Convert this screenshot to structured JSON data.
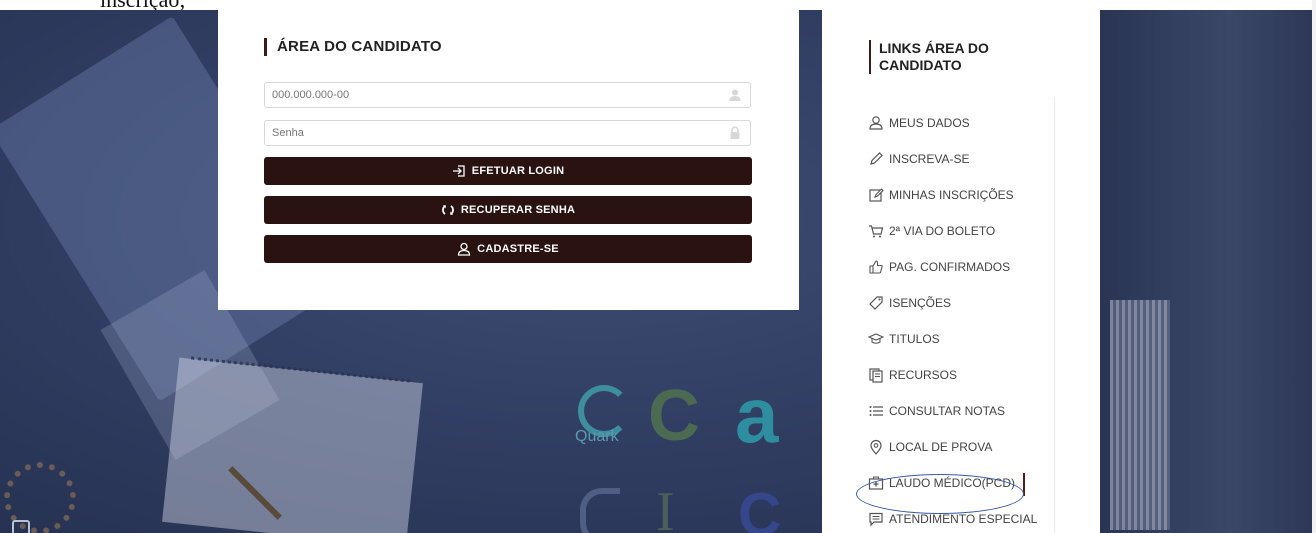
{
  "top_text": "inscrição;",
  "login": {
    "title": "ÁREA DO CANDIDATO",
    "cpf_placeholder": "000.000.000-00",
    "password_placeholder": "Senha",
    "login_button": "EFETUAR LOGIN",
    "recover_button": "RECUPERAR SENHA",
    "register_button": "CADASTRE-SE"
  },
  "sidebar": {
    "title": "LINKS ÁREA DO CANDIDATO",
    "items": [
      {
        "label": "MEUS DADOS",
        "icon": "user-icon"
      },
      {
        "label": "INSCREVA-SE",
        "icon": "pencil-icon"
      },
      {
        "label": "MINHAS INSCRIÇÕES",
        "icon": "edit-icon"
      },
      {
        "label": "2ª VIA DO BOLETO",
        "icon": "cart-icon"
      },
      {
        "label": "PAG. CONFIRMADOS",
        "icon": "thumbs-up-icon"
      },
      {
        "label": "ISENÇÕES",
        "icon": "tag-icon"
      },
      {
        "label": "TITULOS",
        "icon": "graduation-cap-icon"
      },
      {
        "label": "RECURSOS",
        "icon": "documents-icon"
      },
      {
        "label": "CONSULTAR NOTAS",
        "icon": "list-icon"
      },
      {
        "label": "LOCAL DE PROVA",
        "icon": "location-pin-icon"
      },
      {
        "label": "LAUDO MÉDICO(PCD)",
        "icon": "medical-kit-icon"
      },
      {
        "label": "ATENDIMENTO ESPECIAL",
        "icon": "comment-icon"
      }
    ]
  },
  "background_logo_text": "Quark",
  "colors": {
    "button_bg": "#2a1210",
    "accent_bar": "#3b1a17",
    "highlight_ring": "#3a5aa6",
    "background": "#2f3c60"
  }
}
